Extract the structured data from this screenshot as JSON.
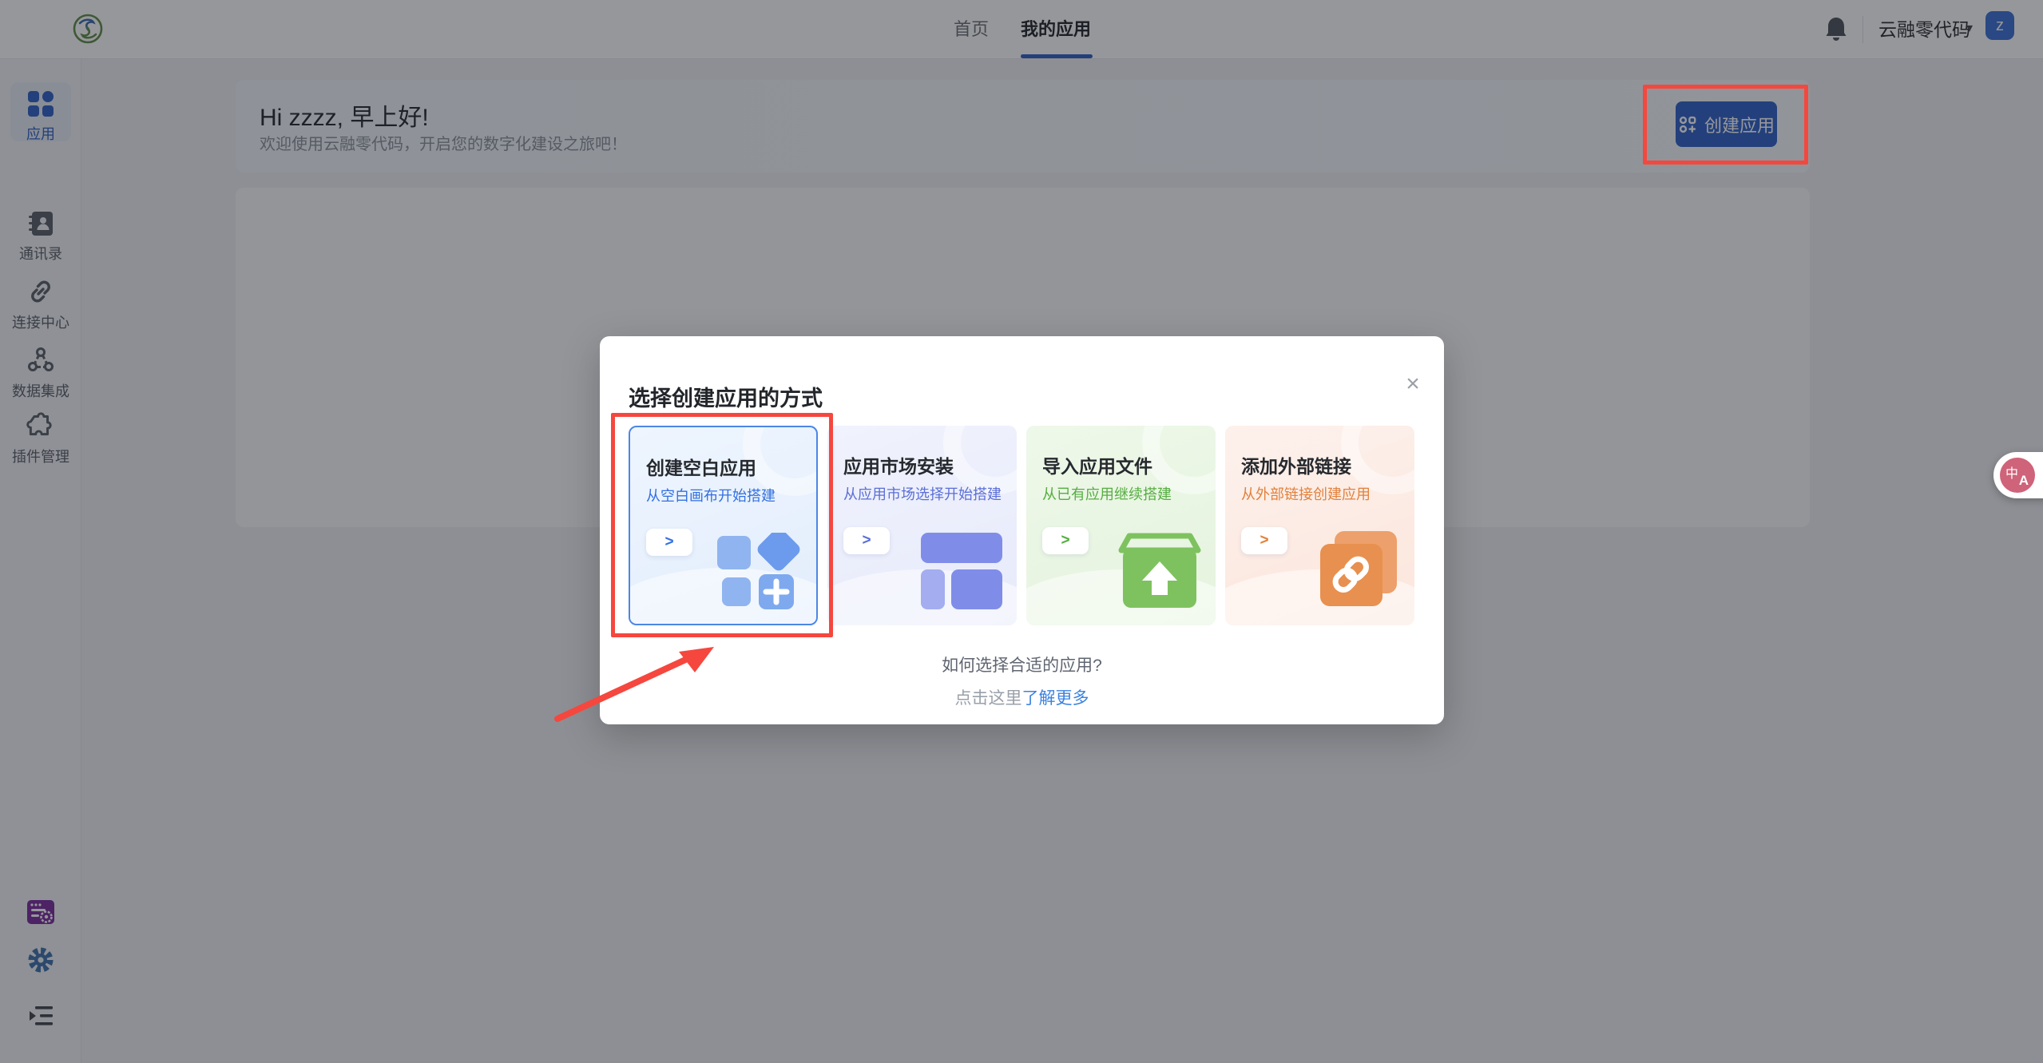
{
  "topbar": {
    "nav": [
      {
        "label": "首页",
        "active": false
      },
      {
        "label": "我的应用",
        "active": true
      }
    ],
    "brand": "云融零代码",
    "brand_caret": "▾",
    "avatar": "z"
  },
  "sidebar": {
    "items": [
      {
        "label": "应用",
        "active": true
      },
      {
        "label": "通讯录",
        "active": false
      },
      {
        "label": "连接中心",
        "active": false
      },
      {
        "label": "数据集成",
        "active": false
      },
      {
        "label": "插件管理",
        "active": false
      }
    ]
  },
  "main": {
    "greeting_title": "Hi zzzz, 早上好!",
    "greeting_subtitle": "欢迎使用云融零代码，开启您的数字化建设之旅吧！",
    "create_button": "创建应用"
  },
  "modal": {
    "title": "选择创建应用的方式",
    "close": "×",
    "cards": [
      {
        "title": "创建空白应用",
        "subtitle": "从空白画布开始搭建",
        "arrow": ">"
      },
      {
        "title": "应用市场安装",
        "subtitle": "从应用市场选择开始搭建",
        "arrow": ">"
      },
      {
        "title": "导入应用文件",
        "subtitle": "从已有应用继续搭建",
        "arrow": ">"
      },
      {
        "title": "添加外部链接",
        "subtitle": "从外部链接创建应用",
        "arrow": ">"
      }
    ],
    "footer_question": "如何选择合适的应用?",
    "footer_prefix": "点击这里",
    "footer_link": "了解更多"
  },
  "fab": {
    "zh": "中",
    "en": "A"
  },
  "colors": {
    "primary": "#2f62c8",
    "annotation_red": "#f5473e",
    "link_blue": "#3b82e0",
    "card_blue": "#3370e0",
    "card_indigo": "#5b6fd6",
    "card_green": "#55ae41",
    "card_orange": "#e2813c",
    "avatar_blue": "#3a6fd8"
  }
}
